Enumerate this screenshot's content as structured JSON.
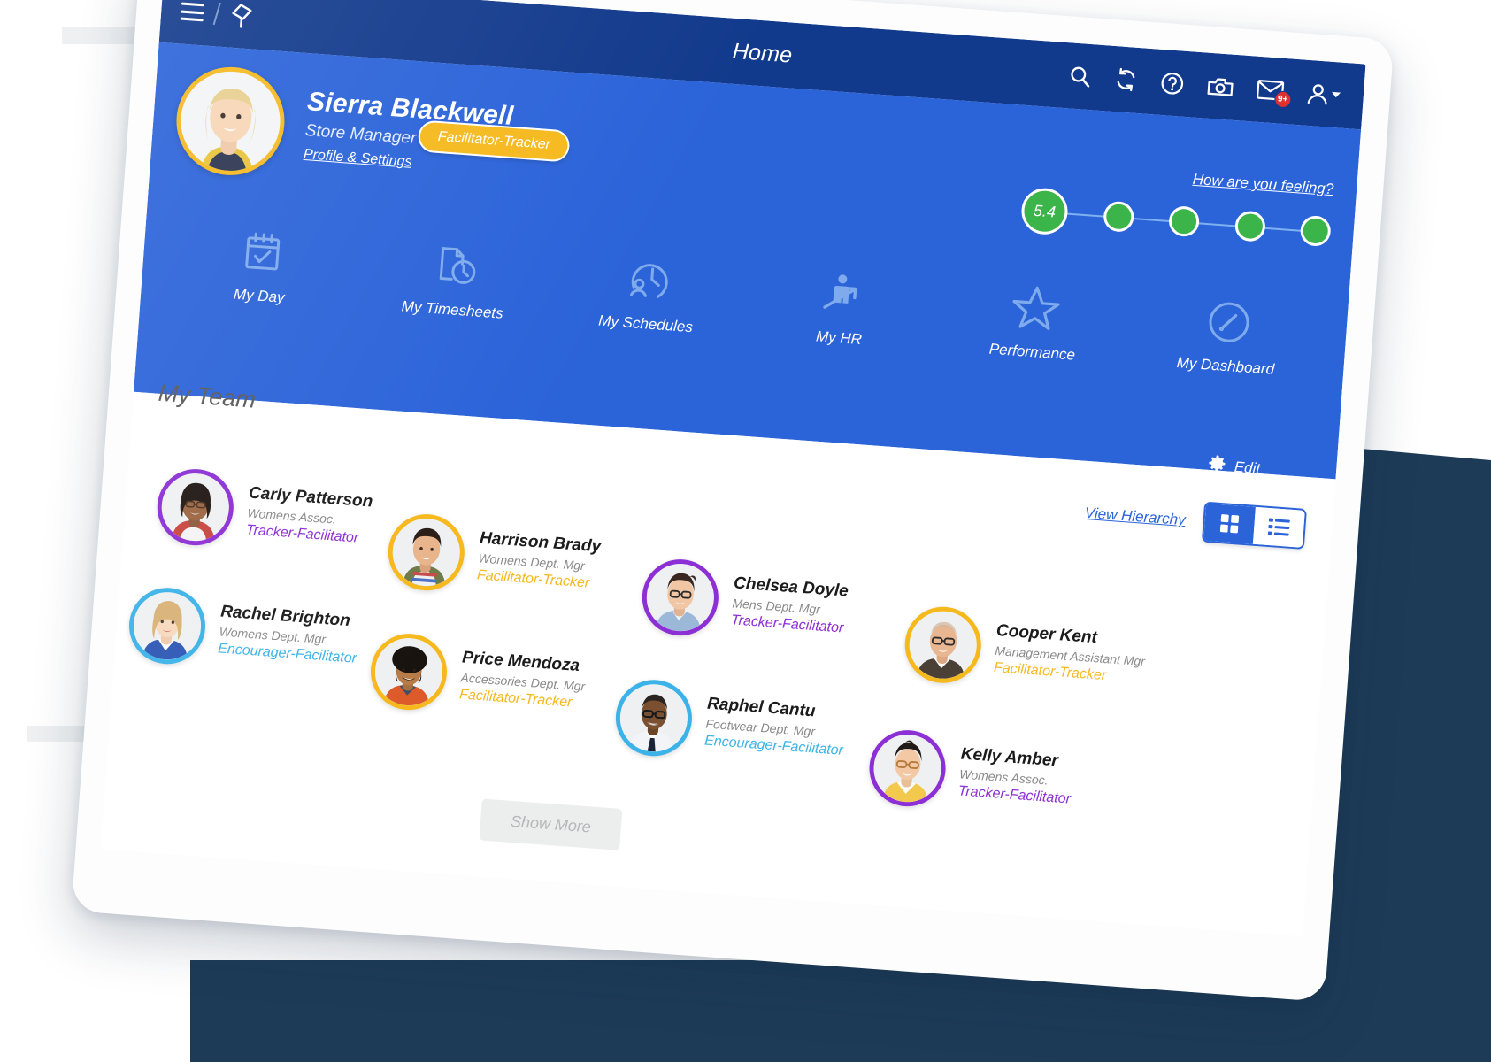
{
  "app": {
    "title": "Home",
    "menu_icon": "hamburger-icon",
    "pin_icon": "pin-icon"
  },
  "topbar_icons": [
    {
      "name": "search-icon",
      "label": "Search"
    },
    {
      "name": "refresh-icon",
      "label": "Refresh"
    },
    {
      "name": "help-icon",
      "label": "Help"
    },
    {
      "name": "camera-icon",
      "label": "Camera"
    },
    {
      "name": "mail-icon",
      "label": "Messages",
      "badge": "9+"
    },
    {
      "name": "user-account-icon",
      "label": "Account"
    }
  ],
  "profile": {
    "name": "Sierra Blackwell",
    "role": "Store Manager",
    "settings_link": "Profile & Settings",
    "badge": "Facilitator-Tracker",
    "badge_color": "#f6b91d"
  },
  "mood": {
    "link": "How are you feeling?",
    "score": "5.4",
    "dot_color": "#3bb44a",
    "dots": [
      "5.4",
      "",
      "",
      "",
      ""
    ]
  },
  "quicknav": [
    {
      "label": "My Day",
      "icon": "calendar-check-icon"
    },
    {
      "label": "My Timesheets",
      "icon": "timesheet-clock-icon"
    },
    {
      "label": "My Schedules",
      "icon": "person-clock-icon"
    },
    {
      "label": "My HR",
      "icon": "person-arrow-up-icon"
    },
    {
      "label": "Performance",
      "icon": "star-icon"
    },
    {
      "label": "My Dashboard",
      "icon": "gauge-icon"
    }
  ],
  "team": {
    "title": "My Team",
    "edit_label": "Edit",
    "edit_icon": "gear-icon",
    "hierarchy_link": "View Hierarchy",
    "view_grid_icon": "grid-view-icon",
    "view_list_icon": "list-view-icon",
    "active_view": "grid",
    "show_more": "Show More",
    "members": [
      {
        "name": "Carly Patterson",
        "dept": "Womens Assoc.",
        "tag": "Tracker-Facilitator",
        "color": "#8c2fd4",
        "skin": "#8d5a3b",
        "hair": "#201713",
        "shirt": "#c8453f"
      },
      {
        "name": "Harrison Brady",
        "dept": "Womens Dept. Mgr",
        "tag": "Facilitator-Tracker",
        "color": "#f6b91d",
        "skin": "#d9a27a",
        "hair": "#2a1d16",
        "shirt": "#6f7a4a"
      },
      {
        "name": "Chelsea Doyle",
        "dept": "Mens Dept. Mgr",
        "tag": "Tracker-Facilitator",
        "color": "#8c2fd4",
        "skin": "#e2b392",
        "hair": "#3a2720",
        "shirt": "#9bb8d8"
      },
      {
        "name": "Cooper Kent",
        "dept": "Management Assistant Mgr",
        "tag": "Facilitator-Tracker",
        "color": "#f6b91d",
        "skin": "#dca882",
        "hair": "#caa98e",
        "shirt": "#4a4035"
      },
      {
        "name": "Rachel Brighton",
        "dept": "Womens Dept. Mgr",
        "tag": "Encourager-Facilitator",
        "color": "#3cb3e8",
        "skin": "#f0cbae",
        "hair": "#d8b277",
        "shirt": "#2f58b5"
      },
      {
        "name": "Price Mendoza",
        "dept": "Accessories Dept. Mgr",
        "tag": "Facilitator-Tracker",
        "color": "#f6b91d",
        "skin": "#a9703f",
        "hair": "#191310",
        "shirt": "#dd5a2a"
      },
      {
        "name": "Raphel Cantu",
        "dept": "Footwear Dept. Mgr",
        "tag": "Encourager-Facilitator",
        "color": "#3cb3e8",
        "skin": "#6b4528",
        "hair": "#2b2421",
        "shirt": "#e9eef5"
      },
      {
        "name": "Kelly Amber",
        "dept": "Womens Assoc.",
        "tag": "Tracker-Facilitator",
        "color": "#8c2fd4",
        "skin": "#e9bf96",
        "hair": "#221a16",
        "shirt": "#f2c94c"
      }
    ]
  },
  "colors": {
    "navbar": "#123a8c",
    "hero": "#2b63d9",
    "accent_yellow": "#f6b91d",
    "accent_purple": "#8c2fd4",
    "accent_blue": "#3cb3e8",
    "green": "#3bb44a",
    "badge_red": "#e03131"
  }
}
